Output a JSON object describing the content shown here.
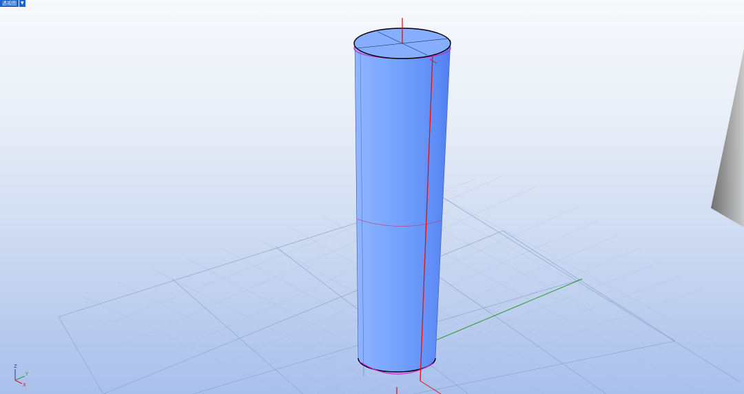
{
  "viewport": {
    "view_name": "透视图",
    "view_menu_icon": "chevron-down-icon"
  },
  "triad": {
    "z_label": "Z",
    "y_label": "Y",
    "x_label": "X"
  },
  "colors": {
    "cylinder": "#6f9dfc",
    "x_axis": "#e01010",
    "y_axis": "#2a9a2a",
    "selection_edge": "#d020d0",
    "grid": "#8aa4cf"
  }
}
